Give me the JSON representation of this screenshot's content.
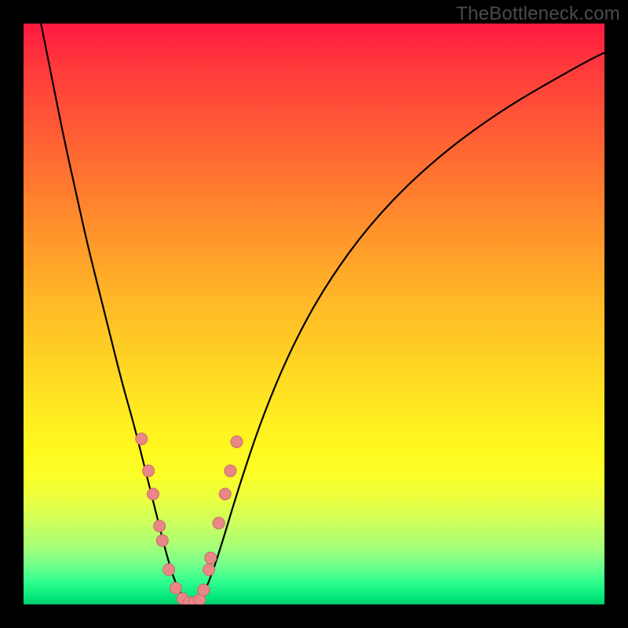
{
  "watermark": "TheBottleneck.com",
  "colors": {
    "curve_stroke": "#000000",
    "marker_fill": "#e98787",
    "marker_stroke": "#c96a6a"
  },
  "chart_data": {
    "type": "line",
    "title": "",
    "xlabel": "",
    "ylabel": "",
    "xlim": [
      0,
      100
    ],
    "ylim": [
      0,
      100
    ],
    "note": "V-shaped bottleneck curve; background gradient encodes severity (red=high, green=low). Numeric values estimated from pixel positions; no axis ticks or labels are shown.",
    "series": [
      {
        "name": "left-branch",
        "x": [
          3,
          5,
          7,
          9,
          11,
          13,
          15,
          17,
          19,
          21,
          23,
          24.5,
          26,
          27.5,
          29
        ],
        "y": [
          100,
          90,
          80,
          71,
          62,
          54,
          46,
          38,
          31,
          23,
          15,
          9,
          4,
          1,
          0
        ]
      },
      {
        "name": "right-branch",
        "x": [
          29,
          30.5,
          32,
          34,
          37,
          41,
          46,
          52,
          60,
          70,
          82,
          96,
          100
        ],
        "y": [
          0,
          1,
          4,
          10,
          20,
          32,
          44,
          55,
          66,
          76,
          85,
          93,
          95
        ]
      }
    ],
    "markers": {
      "name": "sample-points",
      "x": [
        20.3,
        21.5,
        22.3,
        23.4,
        23.9,
        25.0,
        26.2,
        27.4,
        28.5,
        29.4,
        30.3,
        31.0,
        31.9,
        32.2,
        33.6,
        34.7,
        35.6,
        36.7
      ],
      "y": [
        28.5,
        23.0,
        19.0,
        13.5,
        11.0,
        6.0,
        2.8,
        1.0,
        0.3,
        0.3,
        0.8,
        2.5,
        6.0,
        8.0,
        14.0,
        19.0,
        23.0,
        28.0
      ]
    }
  }
}
